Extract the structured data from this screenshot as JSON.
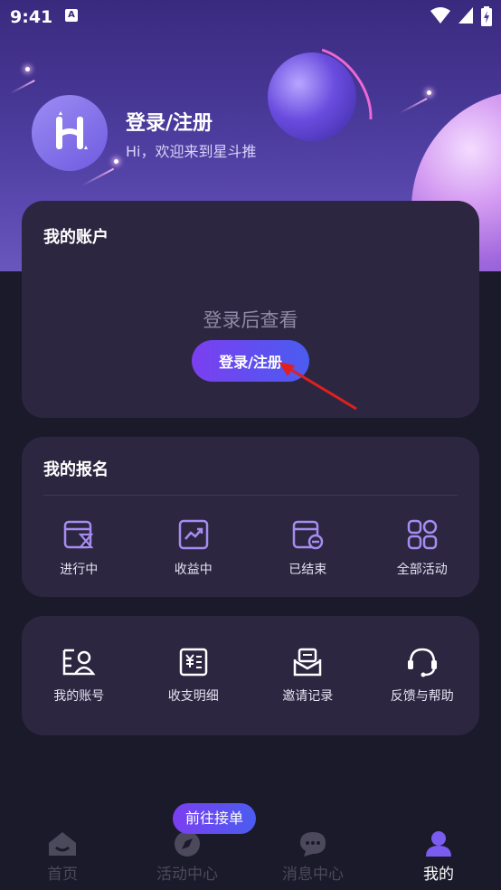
{
  "status_bar": {
    "time": "9:41",
    "notification_badge": "A"
  },
  "header": {
    "login_title": "登录/注册",
    "welcome": "Hi，欢迎来到星斗推",
    "avatar_letter": "H"
  },
  "account_card": {
    "title": "我的账户",
    "hint": "登录后查看",
    "login_button": "登录/注册"
  },
  "signup_card": {
    "title": "我的报名",
    "items": [
      {
        "label": "进行中",
        "icon": "hourglass-icon"
      },
      {
        "label": "收益中",
        "icon": "trend-chart-icon"
      },
      {
        "label": "已结束",
        "icon": "calendar-minus-icon"
      },
      {
        "label": "全部活动",
        "icon": "grid-icon"
      }
    ]
  },
  "tools_card": {
    "items": [
      {
        "label": "我的账号",
        "icon": "user-card-icon"
      },
      {
        "label": "收支明细",
        "icon": "receipt-icon"
      },
      {
        "label": "邀请记录",
        "icon": "envelope-icon"
      },
      {
        "label": "反馈与帮助",
        "icon": "headset-icon"
      }
    ]
  },
  "tab_bar": {
    "bubble": "前往接单",
    "tabs": [
      {
        "label": "首页",
        "icon": "home-icon"
      },
      {
        "label": "活动中心",
        "icon": "compass-icon"
      },
      {
        "label": "消息中心",
        "icon": "chat-icon"
      },
      {
        "label": "我的",
        "icon": "profile-icon",
        "active": true
      }
    ]
  },
  "colors": {
    "accent_start": "#7b3ff0",
    "accent_end": "#4a5cf0",
    "card_bg": "#2c2640",
    "page_bg": "#1b1a2b",
    "icon_purple": "#a58cf0"
  }
}
